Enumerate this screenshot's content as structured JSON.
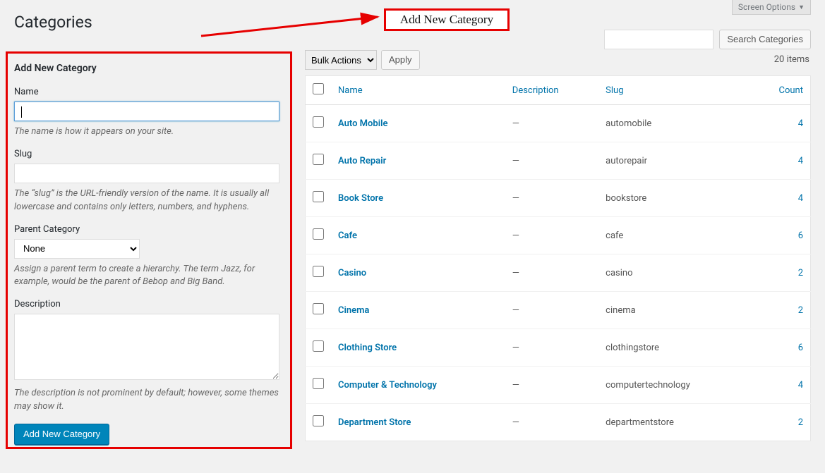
{
  "screen_options_label": "Screen Options",
  "page_title": "Categories",
  "annotation_label": "Add New Category",
  "search": {
    "button": "Search Categories"
  },
  "form": {
    "heading": "Add New Category",
    "name": {
      "label": "Name",
      "value": "",
      "desc": "The name is how it appears on your site."
    },
    "slug": {
      "label": "Slug",
      "value": "",
      "desc": "The “slug” is the URL-friendly version of the name. It is usually all lowercase and contains only letters, numbers, and hyphens."
    },
    "parent": {
      "label": "Parent Category",
      "selected": "None",
      "desc": "Assign a parent term to create a hierarchy. The term Jazz, for example, would be the parent of Bebop and Big Band."
    },
    "description": {
      "label": "Description",
      "value": "",
      "desc": "The description is not prominent by default; however, some themes may show it."
    },
    "submit": "Add New Category"
  },
  "bulk": {
    "selected": "Bulk Actions",
    "apply": "Apply"
  },
  "table": {
    "count_text": "20 items",
    "columns": {
      "name": "Name",
      "description": "Description",
      "slug": "Slug",
      "count": "Count"
    },
    "rows": [
      {
        "name": "Auto Mobile",
        "description": "—",
        "slug": "automobile",
        "count": "4"
      },
      {
        "name": "Auto Repair",
        "description": "—",
        "slug": "autorepair",
        "count": "4"
      },
      {
        "name": "Book Store",
        "description": "—",
        "slug": "bookstore",
        "count": "4"
      },
      {
        "name": "Cafe",
        "description": "—",
        "slug": "cafe",
        "count": "6"
      },
      {
        "name": "Casino",
        "description": "—",
        "slug": "casino",
        "count": "2"
      },
      {
        "name": "Cinema",
        "description": "—",
        "slug": "cinema",
        "count": "2"
      },
      {
        "name": "Clothing Store",
        "description": "—",
        "slug": "clothingstore",
        "count": "6"
      },
      {
        "name": "Computer & Technology",
        "description": "—",
        "slug": "computertechnology",
        "count": "4"
      },
      {
        "name": "Department Store",
        "description": "—",
        "slug": "departmentstore",
        "count": "2"
      }
    ]
  }
}
